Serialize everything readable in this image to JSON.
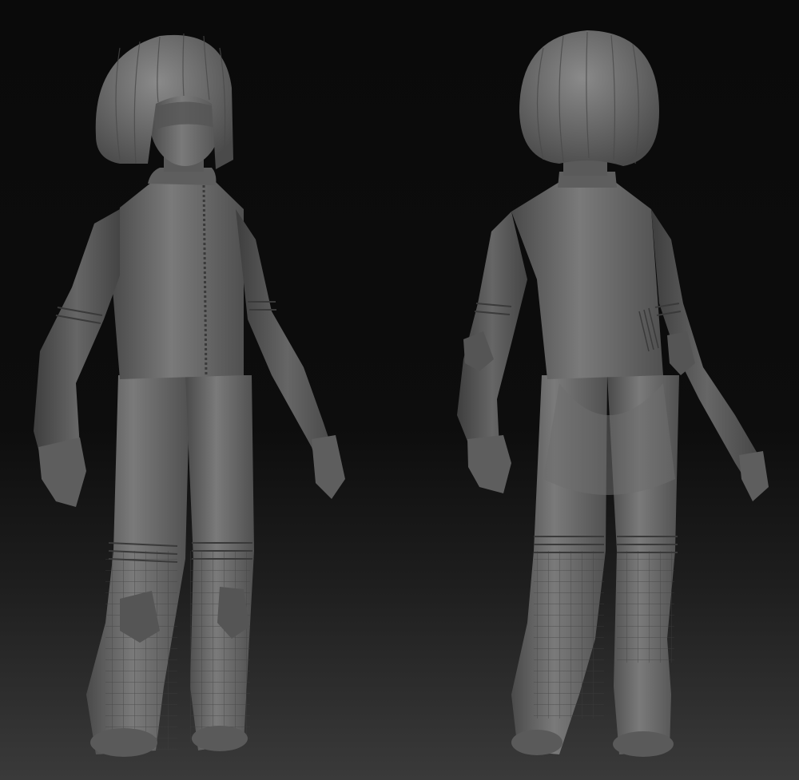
{
  "scene": {
    "background_top": "#0a0a0a",
    "background_bottom": "#3a3a3a",
    "material_color": "#6a6a6a",
    "figures": [
      {
        "view": "front"
      },
      {
        "view": "back"
      }
    ]
  }
}
